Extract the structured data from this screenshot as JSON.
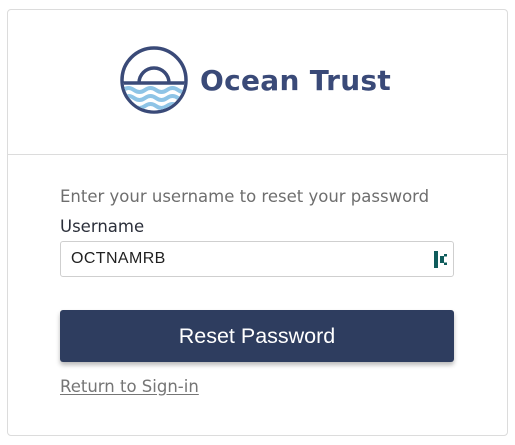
{
  "brand": {
    "name": "Ocean Trust",
    "logo_icon": "sun-over-waves-icon",
    "color": "#3a4a78",
    "wave_color": "#8ec4e6"
  },
  "form": {
    "instructions": "Enter your username to reset your password",
    "username_label": "Username",
    "username_value": "OCTNAMRB",
    "password_manager_icon": "password-manager-icon",
    "submit_label": "Reset Password",
    "return_link": "Return to Sign-in"
  },
  "colors": {
    "button": "#2e3d5f",
    "border": "#dcdcdc"
  }
}
